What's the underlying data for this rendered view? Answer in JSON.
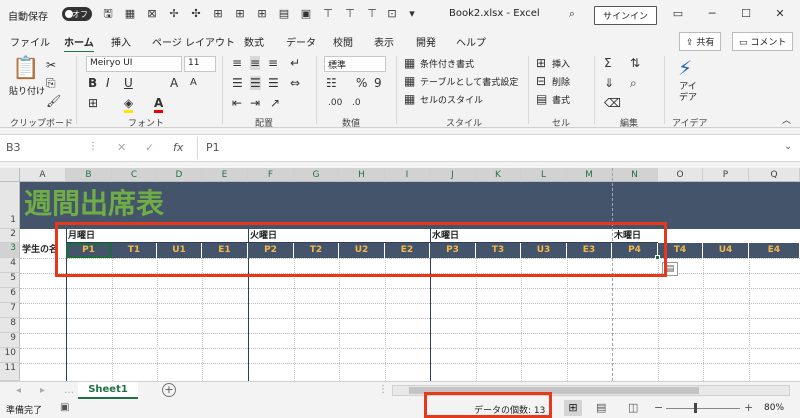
{
  "titlebar": {
    "autosave_label": "自動保存",
    "autosave_state": "オフ",
    "filename": "Book2.xlsx - Excel",
    "signin": "サインイン"
  },
  "menu": {
    "tabs": [
      "ファイル",
      "ホーム",
      "挿入",
      "ページ レイアウト",
      "数式",
      "データ",
      "校閲",
      "表示",
      "開発",
      "ヘルプ"
    ],
    "share": "共有",
    "comment": "コメント"
  },
  "ribbon": {
    "paste": "貼り付け",
    "font_name": "Meiryo UI",
    "font_size": "11",
    "number_format": "標準",
    "conditional": "条件付き書式",
    "table_format": "テーブルとして書式設定",
    "cell_style": "セルのスタイル",
    "insert": "挿入",
    "delete": "削除",
    "format": "書式",
    "ideas": "アイ\nデア",
    "groups": [
      "クリップボード",
      "フォント",
      "配置",
      "数値",
      "スタイル",
      "セル",
      "編集",
      "アイデア"
    ]
  },
  "formula": {
    "namebox": "B3",
    "content": "P1",
    "fx": "fx"
  },
  "columns": [
    "A",
    "B",
    "C",
    "D",
    "E",
    "F",
    "G",
    "H",
    "I",
    "J",
    "K",
    "L",
    "M",
    "N",
    "O",
    "P",
    "Q"
  ],
  "rows": [
    "1",
    "2",
    "3",
    "4",
    "5",
    "6",
    "7",
    "8",
    "9",
    "10",
    "11"
  ],
  "sheet": {
    "title": "週間出席表",
    "days": [
      "月曜日",
      "火曜日",
      "水曜日",
      "木曜日"
    ],
    "row3_label": "学生の名",
    "periods": [
      "P1",
      "T1",
      "U1",
      "E1",
      "P2",
      "T2",
      "U2",
      "E2",
      "P3",
      "T3",
      "U3",
      "E3",
      "P4",
      "T4",
      "U4",
      "E4"
    ]
  },
  "sheet_tab": "Sheet1",
  "status": {
    "ready": "準備完了",
    "count": "データの個数: 13",
    "zoom": "80%"
  },
  "colors": {
    "header_bg": "#44546a",
    "title_green": "#70ad47",
    "period_text": "#f2b84b",
    "highlight_red": "#e8381c",
    "excel_green": "#217346"
  }
}
